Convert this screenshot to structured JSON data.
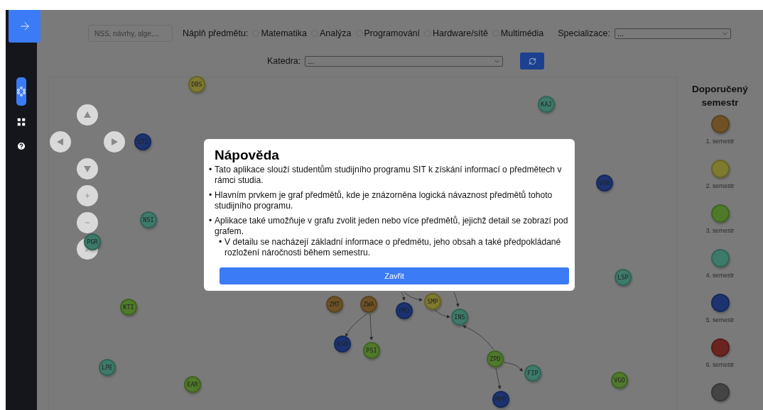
{
  "sidebar": {
    "items": [
      {
        "kind": "graph",
        "selected": true
      },
      {
        "kind": "grid",
        "selected": false
      },
      {
        "kind": "help",
        "selected": false
      }
    ]
  },
  "filters": {
    "search": {
      "placeholder": "NSS, návrhy, alge,..."
    },
    "content_label": "Náplň předmětu:",
    "content_options": [
      {
        "label": "Matematika",
        "selected": false
      },
      {
        "label": "Analýza",
        "selected": false
      },
      {
        "label": "Programování",
        "selected": false
      },
      {
        "label": "Hardware/sítě",
        "selected": false
      },
      {
        "label": "Multimédia",
        "selected": false
      }
    ],
    "specialization": {
      "label": "Specializace:",
      "value": "..."
    },
    "department": {
      "label": "Katedra:",
      "value": "..."
    }
  },
  "graph": {
    "nodes": [
      {
        "label": "DBS",
        "color": "#7e7a2f"
      },
      {
        "label": "ST2",
        "color": "#1c3370"
      },
      {
        "label": "NSI",
        "color": "#3d7a6a"
      },
      {
        "label": "PGR",
        "color": "#3d7a6a"
      },
      {
        "label": "KTI",
        "color": "#4f7a2a"
      },
      {
        "label": "LPE",
        "color": "#3d7a6a"
      },
      {
        "label": "EAR",
        "color": "#4f7a2a"
      },
      {
        "label": "ZMT",
        "color": "#6e5226"
      },
      {
        "label": "ZWA",
        "color": "#6e5226"
      },
      {
        "label": "KSB",
        "color": "#1c3370"
      },
      {
        "label": "PSI",
        "color": "#4f7a2a"
      },
      {
        "label": "PM2",
        "color": "#1c3370"
      },
      {
        "label": "SMP",
        "color": "#7e7a2f"
      },
      {
        "label": "INS",
        "color": "#3d7a6a"
      },
      {
        "label": "ZPD",
        "color": "#4f7a2a"
      },
      {
        "label": "FIP",
        "color": "#3d7a6a"
      },
      {
        "label": "MPR",
        "color": "#1c3370"
      },
      {
        "label": "VGO",
        "color": "#4f7a2a"
      },
      {
        "label": "LSP",
        "color": "#3d7a6a"
      },
      {
        "label": "VAR",
        "color": "#1c3370"
      },
      {
        "label": "KAJ",
        "color": "#3d7a6a"
      }
    ]
  },
  "legend": {
    "title": "Doporučený semestr",
    "items": [
      {
        "label": "1. semestr",
        "color": "#6e5226"
      },
      {
        "label": "2. semestr",
        "color": "#7e7a2f"
      },
      {
        "label": "3. semestr",
        "color": "#4f7a2a"
      },
      {
        "label": "4. semestr",
        "color": "#3d7a6a"
      },
      {
        "label": "5. semestr",
        "color": "#1c3370"
      },
      {
        "label": "6. semestr",
        "color": "#6b2420"
      },
      {
        "color": "#444444"
      }
    ]
  },
  "dialog": {
    "title": "Nápověda",
    "items": [
      {
        "marker": "•",
        "text": "Tato aplikace slouží studentům studijního programu SIT k získání informací o předmětech v rámci studia."
      },
      {
        "marker": "•",
        "text": "Hlavním prvkem je graf předmětů, kde je znázorněna logická návaznost předmětů tohoto studijního programu."
      },
      {
        "marker": "•",
        "text": "Aplikace také umožňuje v grafu zvolit jeden nebo více předmětů, jejichž detail se zobrazí pod grafem.",
        "children": [
          {
            "marker": "•",
            "text": "V detailu se nacházejí základní informace o předmětu, jeho obsah a také předpokládané rozložení náročnosti během semestru."
          }
        ]
      }
    ],
    "button": "Zavřit"
  }
}
